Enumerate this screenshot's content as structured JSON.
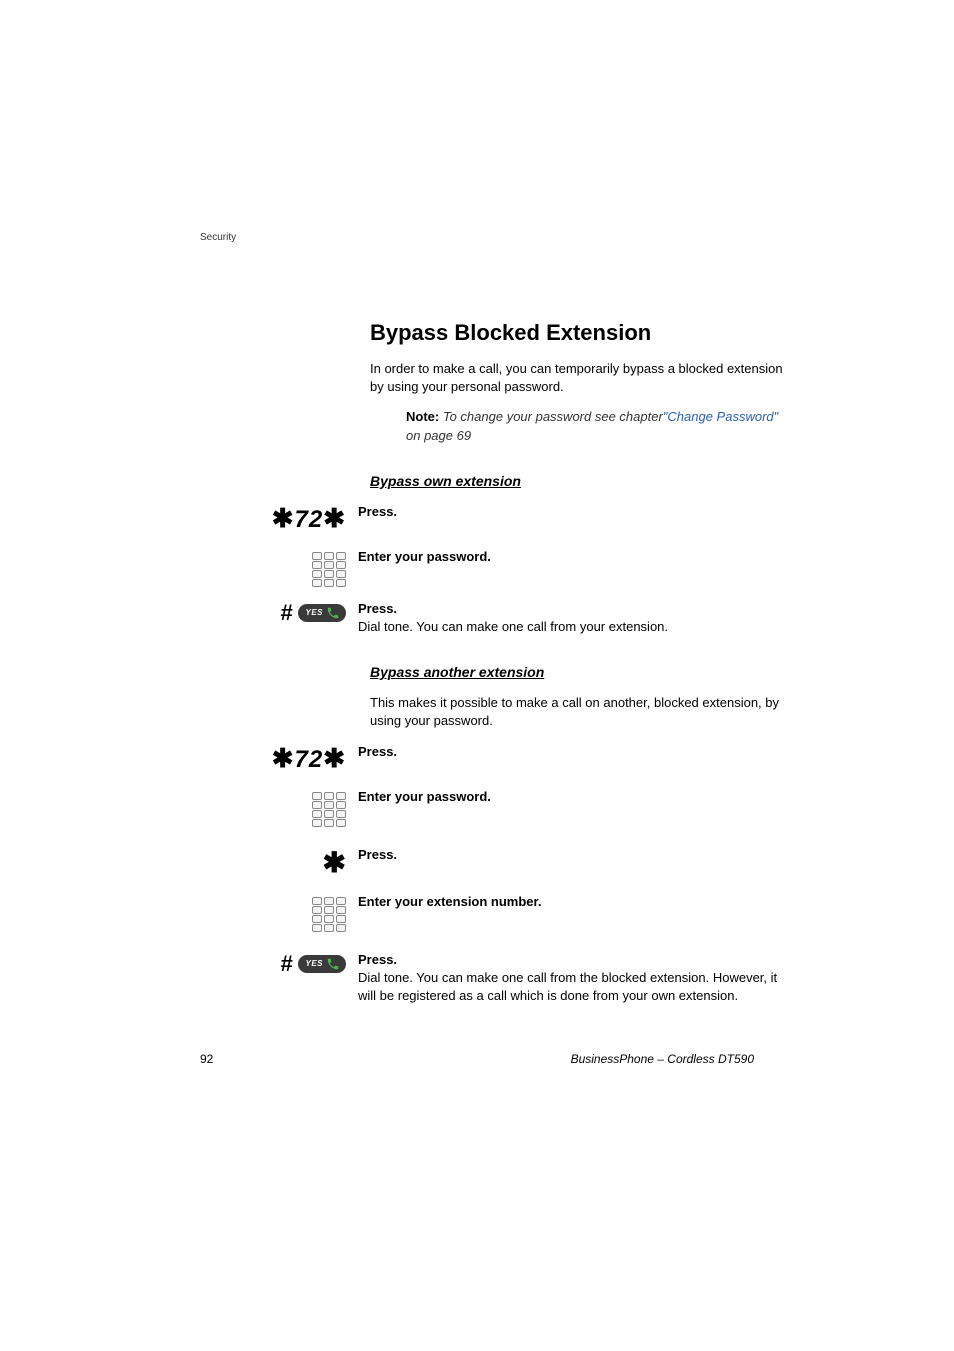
{
  "header": {
    "section": "Security"
  },
  "heading": "Bypass Blocked Extension",
  "intro": "In order to make a call, you can temporarily bypass a blocked extension by using your personal password.",
  "note": {
    "label": "Note:",
    "text1": "To change your password see chapter",
    "link": "\"Change Password\"",
    "text2": " on page 69"
  },
  "section1": {
    "heading": "Bypass own extension",
    "step1": {
      "code": "72",
      "label": "Press."
    },
    "step2": {
      "label": "Enter your password."
    },
    "step3": {
      "label": "Press.",
      "desc": "Dial tone. You can make one call from your extension."
    }
  },
  "section2": {
    "heading": "Bypass another extension",
    "intro": "This makes it possible to make a call on another, blocked extension, by using your password.",
    "step1": {
      "code": "72",
      "label": "Press."
    },
    "step2": {
      "label": "Enter your password."
    },
    "step3": {
      "label": "Press."
    },
    "step4": {
      "label": "Enter your extension number."
    },
    "step5": {
      "label": "Press.",
      "desc": "Dial tone. You can make one call from the blocked extension. However, it will be registered as a call which is done from your own extension."
    }
  },
  "yes_button": {
    "label": "YES"
  },
  "footer": {
    "page": "92",
    "product": "BusinessPhone – Cordless DT590"
  }
}
